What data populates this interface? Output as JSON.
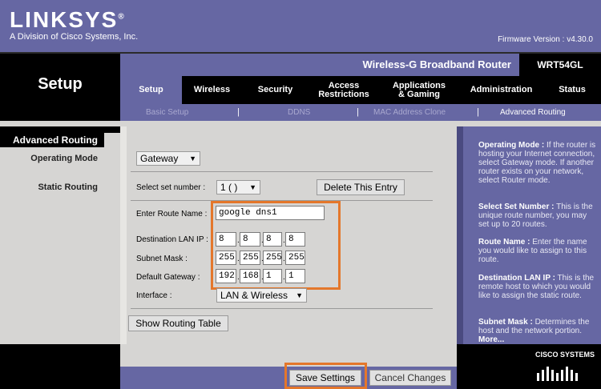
{
  "header": {
    "logo": "LINKSYS",
    "logo_mark": "®",
    "logo_sub": "A Division of Cisco Systems, Inc.",
    "firmware": "Firmware Version  : v4.30.0",
    "product": "Wireless-G Broadband Router",
    "model": "WRT54GL"
  },
  "section": "Setup",
  "tabs": [
    {
      "label": "Setup"
    },
    {
      "label": "Wireless"
    },
    {
      "label": "Security"
    },
    {
      "label": "Access\nRestrictions"
    },
    {
      "label": "Applications\n& Gaming"
    },
    {
      "label": "Administration"
    },
    {
      "label": "Status"
    }
  ],
  "subtabs": [
    "Basic Setup",
    "DDNS",
    "MAC Address Clone",
    "Advanced Routing"
  ],
  "subtab_sep": "|",
  "sidebar": {
    "title": "Advanced Routing",
    "operating_mode": "Operating Mode",
    "static_routing": "Static Routing"
  },
  "form": {
    "operating_mode_value": "Gateway",
    "select_set_label": "Select set number  :",
    "select_set_value": "1 ( )",
    "delete_button": "Delete This Entry",
    "route_name_label": "Enter Route Name  :",
    "route_name_value": "google dns1",
    "dest_ip_label": "Destination LAN IP :",
    "dest_ip": [
      "8",
      "8",
      "8",
      "8"
    ],
    "subnet_label": "Subnet Mask  :",
    "subnet": [
      "255",
      "255",
      "255",
      "255"
    ],
    "gateway_label": "Default Gateway  :",
    "gateway": [
      "192",
      "168",
      "1",
      "1"
    ],
    "interface_label": "Interface  :",
    "interface_value": "LAN & Wireless",
    "show_table_button": "Show Routing Table",
    "octet_sep": "."
  },
  "help": {
    "p1_title": "Operating Mode :",
    "p1_text": " If the router is hosting your Internet connection, select Gateway mode. If another router exists on your network, select Router mode.",
    "p2_title": "Select Set Number :",
    "p2_text": " This is the unique route number, you may set up to 20 routes.",
    "p3_title": "Route Name :",
    "p3_text": " Enter the name you would like to assign to this route.",
    "p4_title": "Destination LAN IP :",
    "p4_text": " This is the remote host to which you would like to assign the static route.",
    "p5_title": "Subnet Mask :",
    "p5_text": " Determines the host and the network portion.",
    "more": "More..."
  },
  "footer": {
    "save": "Save Settings",
    "cancel": "Cancel Changes",
    "cisco": "CISCO SYSTEMS"
  },
  "colors": {
    "brand_purple": "#6667a3",
    "highlight": "#e4772b"
  }
}
